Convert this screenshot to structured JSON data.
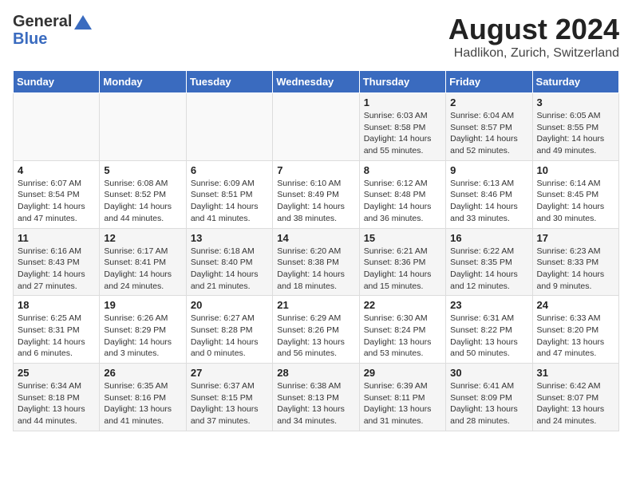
{
  "header": {
    "logo_general": "General",
    "logo_blue": "Blue",
    "main_title": "August 2024",
    "subtitle": "Hadlikon, Zurich, Switzerland"
  },
  "calendar": {
    "days_of_week": [
      "Sunday",
      "Monday",
      "Tuesday",
      "Wednesday",
      "Thursday",
      "Friday",
      "Saturday"
    ],
    "weeks": [
      [
        {
          "day": "",
          "detail": ""
        },
        {
          "day": "",
          "detail": ""
        },
        {
          "day": "",
          "detail": ""
        },
        {
          "day": "",
          "detail": ""
        },
        {
          "day": "1",
          "detail": "Sunrise: 6:03 AM\nSunset: 8:58 PM\nDaylight: 14 hours\nand 55 minutes."
        },
        {
          "day": "2",
          "detail": "Sunrise: 6:04 AM\nSunset: 8:57 PM\nDaylight: 14 hours\nand 52 minutes."
        },
        {
          "day": "3",
          "detail": "Sunrise: 6:05 AM\nSunset: 8:55 PM\nDaylight: 14 hours\nand 49 minutes."
        }
      ],
      [
        {
          "day": "4",
          "detail": "Sunrise: 6:07 AM\nSunset: 8:54 PM\nDaylight: 14 hours\nand 47 minutes."
        },
        {
          "day": "5",
          "detail": "Sunrise: 6:08 AM\nSunset: 8:52 PM\nDaylight: 14 hours\nand 44 minutes."
        },
        {
          "day": "6",
          "detail": "Sunrise: 6:09 AM\nSunset: 8:51 PM\nDaylight: 14 hours\nand 41 minutes."
        },
        {
          "day": "7",
          "detail": "Sunrise: 6:10 AM\nSunset: 8:49 PM\nDaylight: 14 hours\nand 38 minutes."
        },
        {
          "day": "8",
          "detail": "Sunrise: 6:12 AM\nSunset: 8:48 PM\nDaylight: 14 hours\nand 36 minutes."
        },
        {
          "day": "9",
          "detail": "Sunrise: 6:13 AM\nSunset: 8:46 PM\nDaylight: 14 hours\nand 33 minutes."
        },
        {
          "day": "10",
          "detail": "Sunrise: 6:14 AM\nSunset: 8:45 PM\nDaylight: 14 hours\nand 30 minutes."
        }
      ],
      [
        {
          "day": "11",
          "detail": "Sunrise: 6:16 AM\nSunset: 8:43 PM\nDaylight: 14 hours\nand 27 minutes."
        },
        {
          "day": "12",
          "detail": "Sunrise: 6:17 AM\nSunset: 8:41 PM\nDaylight: 14 hours\nand 24 minutes."
        },
        {
          "day": "13",
          "detail": "Sunrise: 6:18 AM\nSunset: 8:40 PM\nDaylight: 14 hours\nand 21 minutes."
        },
        {
          "day": "14",
          "detail": "Sunrise: 6:20 AM\nSunset: 8:38 PM\nDaylight: 14 hours\nand 18 minutes."
        },
        {
          "day": "15",
          "detail": "Sunrise: 6:21 AM\nSunset: 8:36 PM\nDaylight: 14 hours\nand 15 minutes."
        },
        {
          "day": "16",
          "detail": "Sunrise: 6:22 AM\nSunset: 8:35 PM\nDaylight: 14 hours\nand 12 minutes."
        },
        {
          "day": "17",
          "detail": "Sunrise: 6:23 AM\nSunset: 8:33 PM\nDaylight: 14 hours\nand 9 minutes."
        }
      ],
      [
        {
          "day": "18",
          "detail": "Sunrise: 6:25 AM\nSunset: 8:31 PM\nDaylight: 14 hours\nand 6 minutes."
        },
        {
          "day": "19",
          "detail": "Sunrise: 6:26 AM\nSunset: 8:29 PM\nDaylight: 14 hours\nand 3 minutes."
        },
        {
          "day": "20",
          "detail": "Sunrise: 6:27 AM\nSunset: 8:28 PM\nDaylight: 14 hours\nand 0 minutes."
        },
        {
          "day": "21",
          "detail": "Sunrise: 6:29 AM\nSunset: 8:26 PM\nDaylight: 13 hours\nand 56 minutes."
        },
        {
          "day": "22",
          "detail": "Sunrise: 6:30 AM\nSunset: 8:24 PM\nDaylight: 13 hours\nand 53 minutes."
        },
        {
          "day": "23",
          "detail": "Sunrise: 6:31 AM\nSunset: 8:22 PM\nDaylight: 13 hours\nand 50 minutes."
        },
        {
          "day": "24",
          "detail": "Sunrise: 6:33 AM\nSunset: 8:20 PM\nDaylight: 13 hours\nand 47 minutes."
        }
      ],
      [
        {
          "day": "25",
          "detail": "Sunrise: 6:34 AM\nSunset: 8:18 PM\nDaylight: 13 hours\nand 44 minutes."
        },
        {
          "day": "26",
          "detail": "Sunrise: 6:35 AM\nSunset: 8:16 PM\nDaylight: 13 hours\nand 41 minutes."
        },
        {
          "day": "27",
          "detail": "Sunrise: 6:37 AM\nSunset: 8:15 PM\nDaylight: 13 hours\nand 37 minutes."
        },
        {
          "day": "28",
          "detail": "Sunrise: 6:38 AM\nSunset: 8:13 PM\nDaylight: 13 hours\nand 34 minutes."
        },
        {
          "day": "29",
          "detail": "Sunrise: 6:39 AM\nSunset: 8:11 PM\nDaylight: 13 hours\nand 31 minutes."
        },
        {
          "day": "30",
          "detail": "Sunrise: 6:41 AM\nSunset: 8:09 PM\nDaylight: 13 hours\nand 28 minutes."
        },
        {
          "day": "31",
          "detail": "Sunrise: 6:42 AM\nSunset: 8:07 PM\nDaylight: 13 hours\nand 24 minutes."
        }
      ]
    ]
  }
}
